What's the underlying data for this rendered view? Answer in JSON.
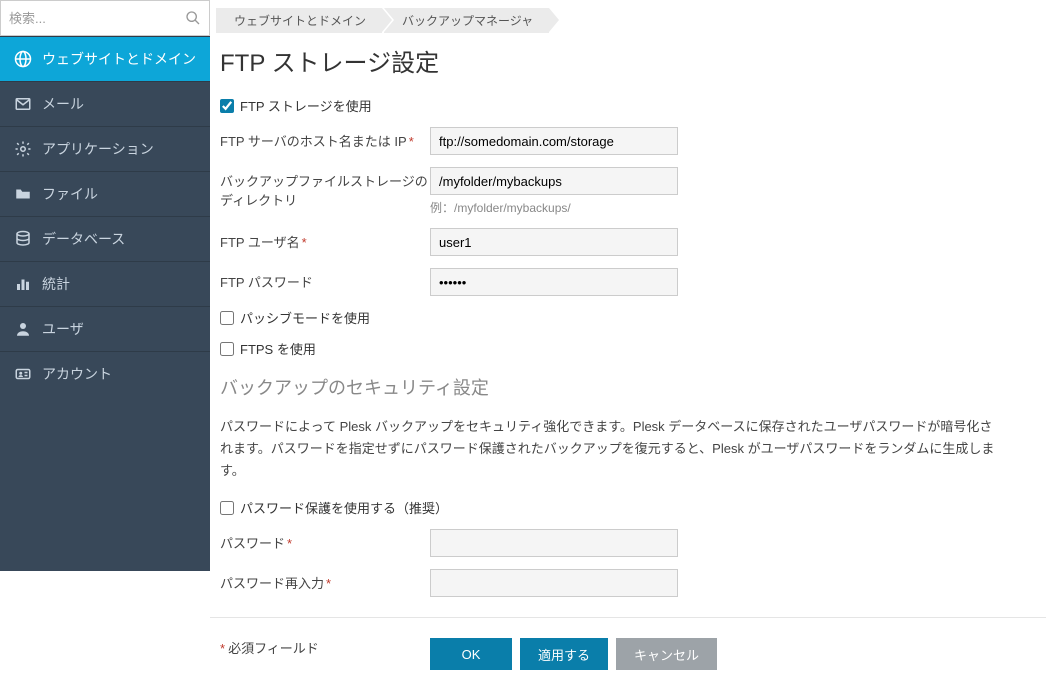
{
  "search": {
    "placeholder": "検索..."
  },
  "sidebar": {
    "items": [
      {
        "label": "ウェブサイトとドメイン",
        "icon": "globe"
      },
      {
        "label": "メール",
        "icon": "mail"
      },
      {
        "label": "アプリケーション",
        "icon": "gear"
      },
      {
        "label": "ファイル",
        "icon": "folder"
      },
      {
        "label": "データベース",
        "icon": "database"
      },
      {
        "label": "統計",
        "icon": "stats"
      },
      {
        "label": "ユーザ",
        "icon": "user"
      },
      {
        "label": "アカウント",
        "icon": "idcard"
      }
    ]
  },
  "breadcrumb": [
    "ウェブサイトとドメイン",
    "バックアップマネージャ"
  ],
  "page_title": "FTP ストレージ設定",
  "form": {
    "use_ftp_label": "FTP ストレージを使用",
    "host_label": "FTP サーバのホスト名または IP",
    "host_value": "ftp://somedomain.com/storage",
    "dir_label": "バックアップファイルストレージのディレクトリ",
    "dir_value": "/myfolder/mybackups",
    "dir_hint": "例：/myfolder/mybackups/",
    "user_label": "FTP ユーザ名",
    "user_value": "user1",
    "pass_label": "FTP パスワード",
    "pass_value": "••••••",
    "passive_label": "パッシブモードを使用",
    "ftps_label": "FTPS を使用"
  },
  "security": {
    "heading": "バックアップのセキュリティ設定",
    "description": "パスワードによって Plesk バックアップをセキュリティ強化できます。Plesk データベースに保存されたユーザパスワードが暗号化されます。パスワードを指定せずにパスワード保護されたバックアップを復元すると、Plesk がユーザパスワードをランダムに生成します。",
    "protect_label": "パスワード保護を使用する（推奨）",
    "pw_label": "パスワード",
    "pw2_label": "パスワード再入力"
  },
  "footer": {
    "required_note": "必須フィールド",
    "ok": "OK",
    "apply": "適用する",
    "cancel": "キャンセル"
  }
}
